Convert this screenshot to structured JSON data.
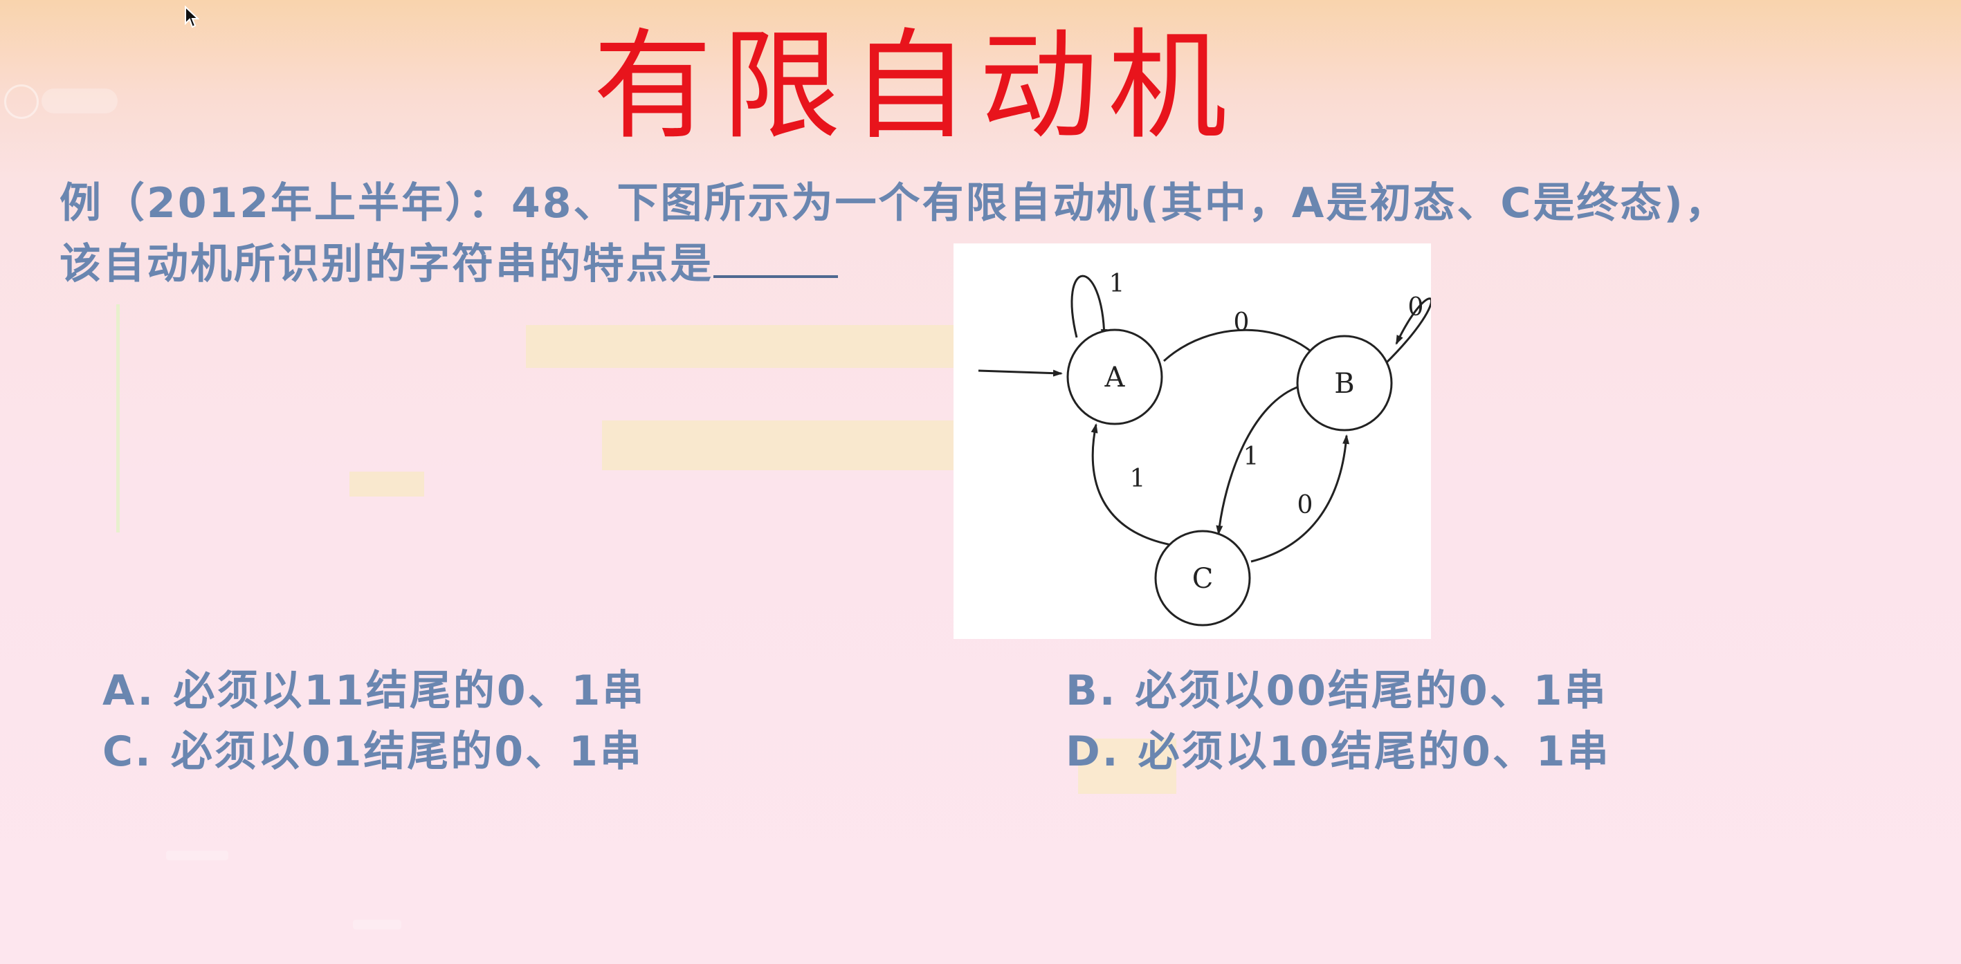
{
  "slide": {
    "title": "有限自动机",
    "question": {
      "line1": "例（2012年上半年）：48、下图所示为一个有限自动机(其中，A是初态、C是终态)，",
      "line2": "该自动机所识别的字符串的特点是"
    },
    "options": [
      {
        "letter": "A.",
        "text": "必须以11结尾的0、1串"
      },
      {
        "letter": "B.",
        "text": "必须以00结尾的0、1串"
      },
      {
        "letter": "C.",
        "text": "必须以01结尾的0、1串"
      },
      {
        "letter": "D.",
        "text": "必须以10结尾的0、1串"
      }
    ]
  },
  "diagram": {
    "states": [
      "A",
      "B",
      "C"
    ],
    "initial_state": "A",
    "final_state": "C",
    "transitions": [
      {
        "from": "A",
        "to": "A",
        "label": "1"
      },
      {
        "from": "A",
        "to": "B",
        "label": "0"
      },
      {
        "from": "B",
        "to": "B",
        "label": "0"
      },
      {
        "from": "B",
        "to": "C",
        "label": "1"
      },
      {
        "from": "C",
        "to": "A",
        "label": "1"
      },
      {
        "from": "C",
        "to": "B",
        "label": "0"
      }
    ]
  },
  "colors": {
    "title": "#e8141c",
    "text": "#6a86b0",
    "diagram_stroke": "#222222"
  },
  "icons": {
    "cursor": "mouse-pointer-icon"
  }
}
